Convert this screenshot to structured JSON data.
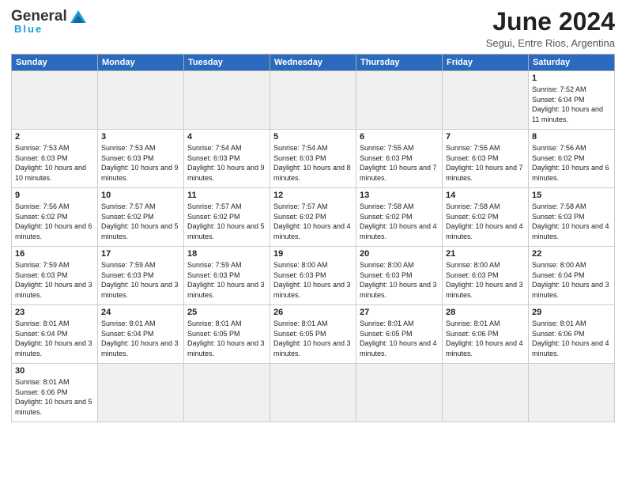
{
  "header": {
    "logo_general": "General",
    "logo_blue": "Blue",
    "month_year": "June 2024",
    "location": "Segui, Entre Rios, Argentina"
  },
  "days_of_week": [
    "Sunday",
    "Monday",
    "Tuesday",
    "Wednesday",
    "Thursday",
    "Friday",
    "Saturday"
  ],
  "weeks": [
    [
      {
        "day": "",
        "info": ""
      },
      {
        "day": "",
        "info": ""
      },
      {
        "day": "",
        "info": ""
      },
      {
        "day": "",
        "info": ""
      },
      {
        "day": "",
        "info": ""
      },
      {
        "day": "",
        "info": ""
      },
      {
        "day": "1",
        "info": "Sunrise: 7:52 AM\nSunset: 6:04 PM\nDaylight: 10 hours and 11 minutes."
      }
    ],
    [
      {
        "day": "2",
        "info": "Sunrise: 7:53 AM\nSunset: 6:03 PM\nDaylight: 10 hours and 10 minutes."
      },
      {
        "day": "3",
        "info": "Sunrise: 7:53 AM\nSunset: 6:03 PM\nDaylight: 10 hours and 9 minutes."
      },
      {
        "day": "4",
        "info": "Sunrise: 7:54 AM\nSunset: 6:03 PM\nDaylight: 10 hours and 9 minutes."
      },
      {
        "day": "5",
        "info": "Sunrise: 7:54 AM\nSunset: 6:03 PM\nDaylight: 10 hours and 8 minutes."
      },
      {
        "day": "6",
        "info": "Sunrise: 7:55 AM\nSunset: 6:03 PM\nDaylight: 10 hours and 7 minutes."
      },
      {
        "day": "7",
        "info": "Sunrise: 7:55 AM\nSunset: 6:03 PM\nDaylight: 10 hours and 7 minutes."
      },
      {
        "day": "8",
        "info": "Sunrise: 7:56 AM\nSunset: 6:02 PM\nDaylight: 10 hours and 6 minutes."
      }
    ],
    [
      {
        "day": "9",
        "info": "Sunrise: 7:56 AM\nSunset: 6:02 PM\nDaylight: 10 hours and 6 minutes."
      },
      {
        "day": "10",
        "info": "Sunrise: 7:57 AM\nSunset: 6:02 PM\nDaylight: 10 hours and 5 minutes."
      },
      {
        "day": "11",
        "info": "Sunrise: 7:57 AM\nSunset: 6:02 PM\nDaylight: 10 hours and 5 minutes."
      },
      {
        "day": "12",
        "info": "Sunrise: 7:57 AM\nSunset: 6:02 PM\nDaylight: 10 hours and 4 minutes."
      },
      {
        "day": "13",
        "info": "Sunrise: 7:58 AM\nSunset: 6:02 PM\nDaylight: 10 hours and 4 minutes."
      },
      {
        "day": "14",
        "info": "Sunrise: 7:58 AM\nSunset: 6:02 PM\nDaylight: 10 hours and 4 minutes."
      },
      {
        "day": "15",
        "info": "Sunrise: 7:58 AM\nSunset: 6:03 PM\nDaylight: 10 hours and 4 minutes."
      }
    ],
    [
      {
        "day": "16",
        "info": "Sunrise: 7:59 AM\nSunset: 6:03 PM\nDaylight: 10 hours and 3 minutes."
      },
      {
        "day": "17",
        "info": "Sunrise: 7:59 AM\nSunset: 6:03 PM\nDaylight: 10 hours and 3 minutes."
      },
      {
        "day": "18",
        "info": "Sunrise: 7:59 AM\nSunset: 6:03 PM\nDaylight: 10 hours and 3 minutes."
      },
      {
        "day": "19",
        "info": "Sunrise: 8:00 AM\nSunset: 6:03 PM\nDaylight: 10 hours and 3 minutes."
      },
      {
        "day": "20",
        "info": "Sunrise: 8:00 AM\nSunset: 6:03 PM\nDaylight: 10 hours and 3 minutes."
      },
      {
        "day": "21",
        "info": "Sunrise: 8:00 AM\nSunset: 6:03 PM\nDaylight: 10 hours and 3 minutes."
      },
      {
        "day": "22",
        "info": "Sunrise: 8:00 AM\nSunset: 6:04 PM\nDaylight: 10 hours and 3 minutes."
      }
    ],
    [
      {
        "day": "23",
        "info": "Sunrise: 8:01 AM\nSunset: 6:04 PM\nDaylight: 10 hours and 3 minutes."
      },
      {
        "day": "24",
        "info": "Sunrise: 8:01 AM\nSunset: 6:04 PM\nDaylight: 10 hours and 3 minutes."
      },
      {
        "day": "25",
        "info": "Sunrise: 8:01 AM\nSunset: 6:05 PM\nDaylight: 10 hours and 3 minutes."
      },
      {
        "day": "26",
        "info": "Sunrise: 8:01 AM\nSunset: 6:05 PM\nDaylight: 10 hours and 3 minutes."
      },
      {
        "day": "27",
        "info": "Sunrise: 8:01 AM\nSunset: 6:05 PM\nDaylight: 10 hours and 4 minutes."
      },
      {
        "day": "28",
        "info": "Sunrise: 8:01 AM\nSunset: 6:06 PM\nDaylight: 10 hours and 4 minutes."
      },
      {
        "day": "29",
        "info": "Sunrise: 8:01 AM\nSunset: 6:06 PM\nDaylight: 10 hours and 4 minutes."
      }
    ],
    [
      {
        "day": "30",
        "info": "Sunrise: 8:01 AM\nSunset: 6:06 PM\nDaylight: 10 hours and 5 minutes."
      },
      {
        "day": "",
        "info": ""
      },
      {
        "day": "",
        "info": ""
      },
      {
        "day": "",
        "info": ""
      },
      {
        "day": "",
        "info": ""
      },
      {
        "day": "",
        "info": ""
      },
      {
        "day": "",
        "info": ""
      }
    ]
  ]
}
